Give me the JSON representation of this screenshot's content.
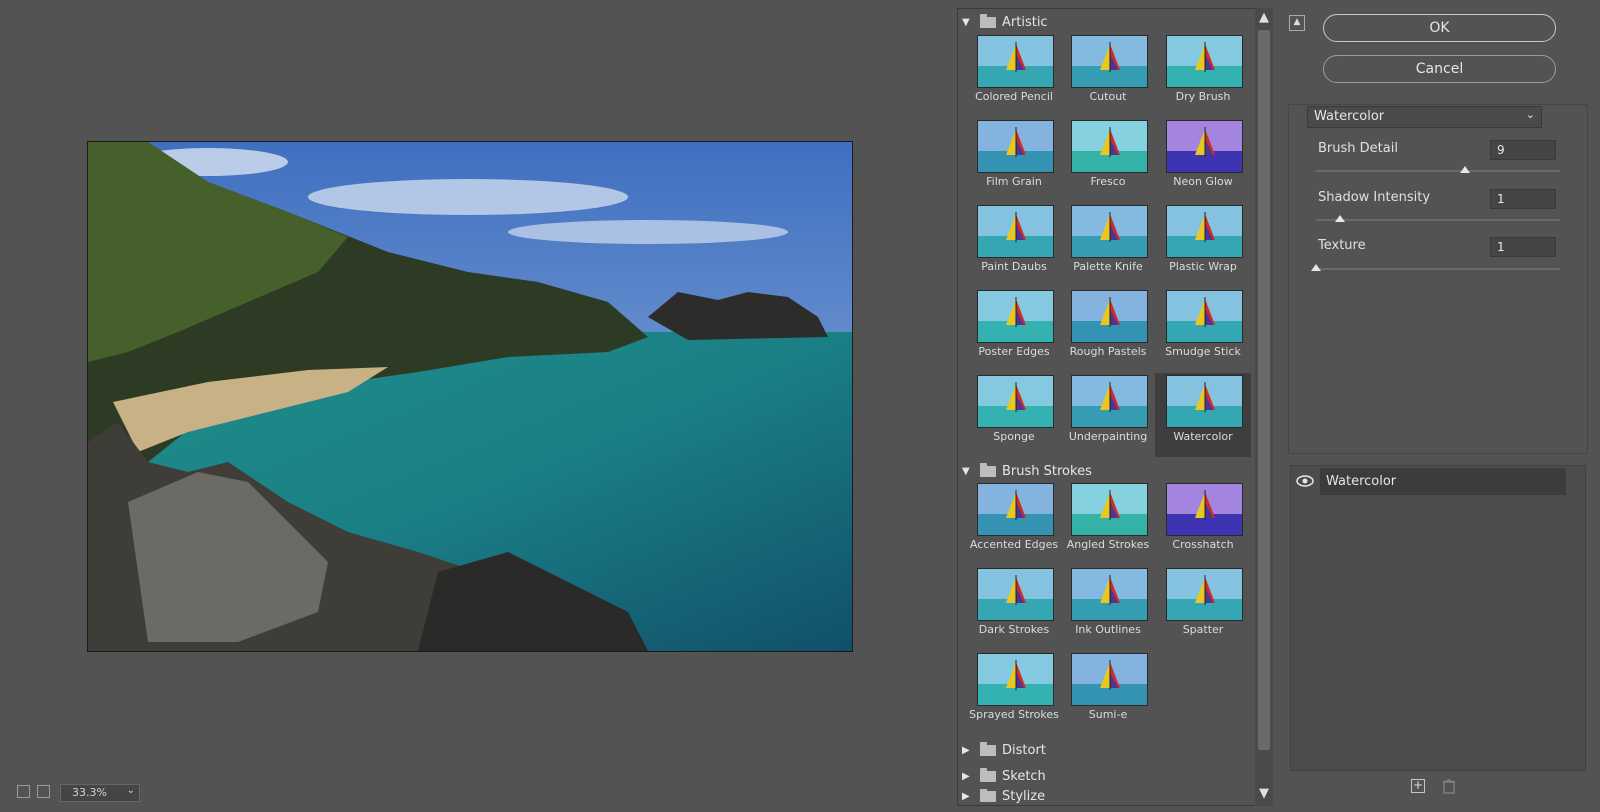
{
  "zoom": {
    "value": "33.3%"
  },
  "gallery": {
    "categories": [
      {
        "name": "Artistic",
        "expanded": true,
        "filters": [
          "Colored Pencil",
          "Cutout",
          "Dry Brush",
          "Film Grain",
          "Fresco",
          "Neon Glow",
          "Paint Daubs",
          "Palette Knife",
          "Plastic Wrap",
          "Poster Edges",
          "Rough Pastels",
          "Smudge Stick",
          "Sponge",
          "Underpainting",
          "Watercolor"
        ]
      },
      {
        "name": "Brush Strokes",
        "expanded": true,
        "filters": [
          "Accented Edges",
          "Angled Strokes",
          "Crosshatch",
          "Dark Strokes",
          "Ink Outlines",
          "Spatter",
          "Sprayed Strokes",
          "Sumi-e"
        ]
      },
      {
        "name": "Distort",
        "expanded": false,
        "filters": []
      },
      {
        "name": "Sketch",
        "expanded": false,
        "filters": []
      },
      {
        "name": "Stylize",
        "expanded": false,
        "filters": []
      }
    ],
    "selected_filter": "Watercolor"
  },
  "buttons": {
    "ok": "OK",
    "cancel": "Cancel"
  },
  "settings": {
    "filter": "Watercolor",
    "params": [
      {
        "label": "Brush Detail",
        "value": "9",
        "fraction": 0.61
      },
      {
        "label": "Shadow Intensity",
        "value": "1",
        "fraction": 0.1
      },
      {
        "label": "Texture",
        "value": "1",
        "fraction": 0.0
      }
    ]
  },
  "layers": [
    {
      "name": "Watercolor",
      "visible": true
    }
  ]
}
